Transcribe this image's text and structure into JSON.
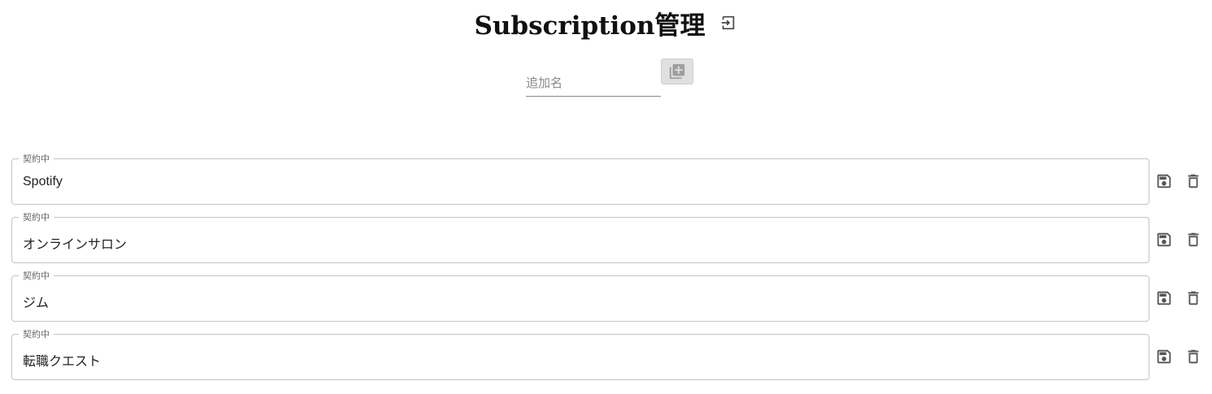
{
  "header": {
    "title": "Subscription管理",
    "logout_icon": "logout-icon"
  },
  "add": {
    "placeholder": "追加名",
    "value": "",
    "button_icon": "library-add-icon"
  },
  "items": [
    {
      "status_label": "契約中",
      "name": "Spotify"
    },
    {
      "status_label": "契約中",
      "name": "オンラインサロン"
    },
    {
      "status_label": "契約中",
      "name": "ジム"
    },
    {
      "status_label": "契約中",
      "name": "転職クエスト"
    }
  ],
  "item_actions": {
    "save_icon": "save-icon",
    "delete_icon": "delete-icon"
  },
  "colors": {
    "icon": "#555555",
    "border": "#c4c4c4",
    "add_button_bg": "#e0e0e0"
  }
}
